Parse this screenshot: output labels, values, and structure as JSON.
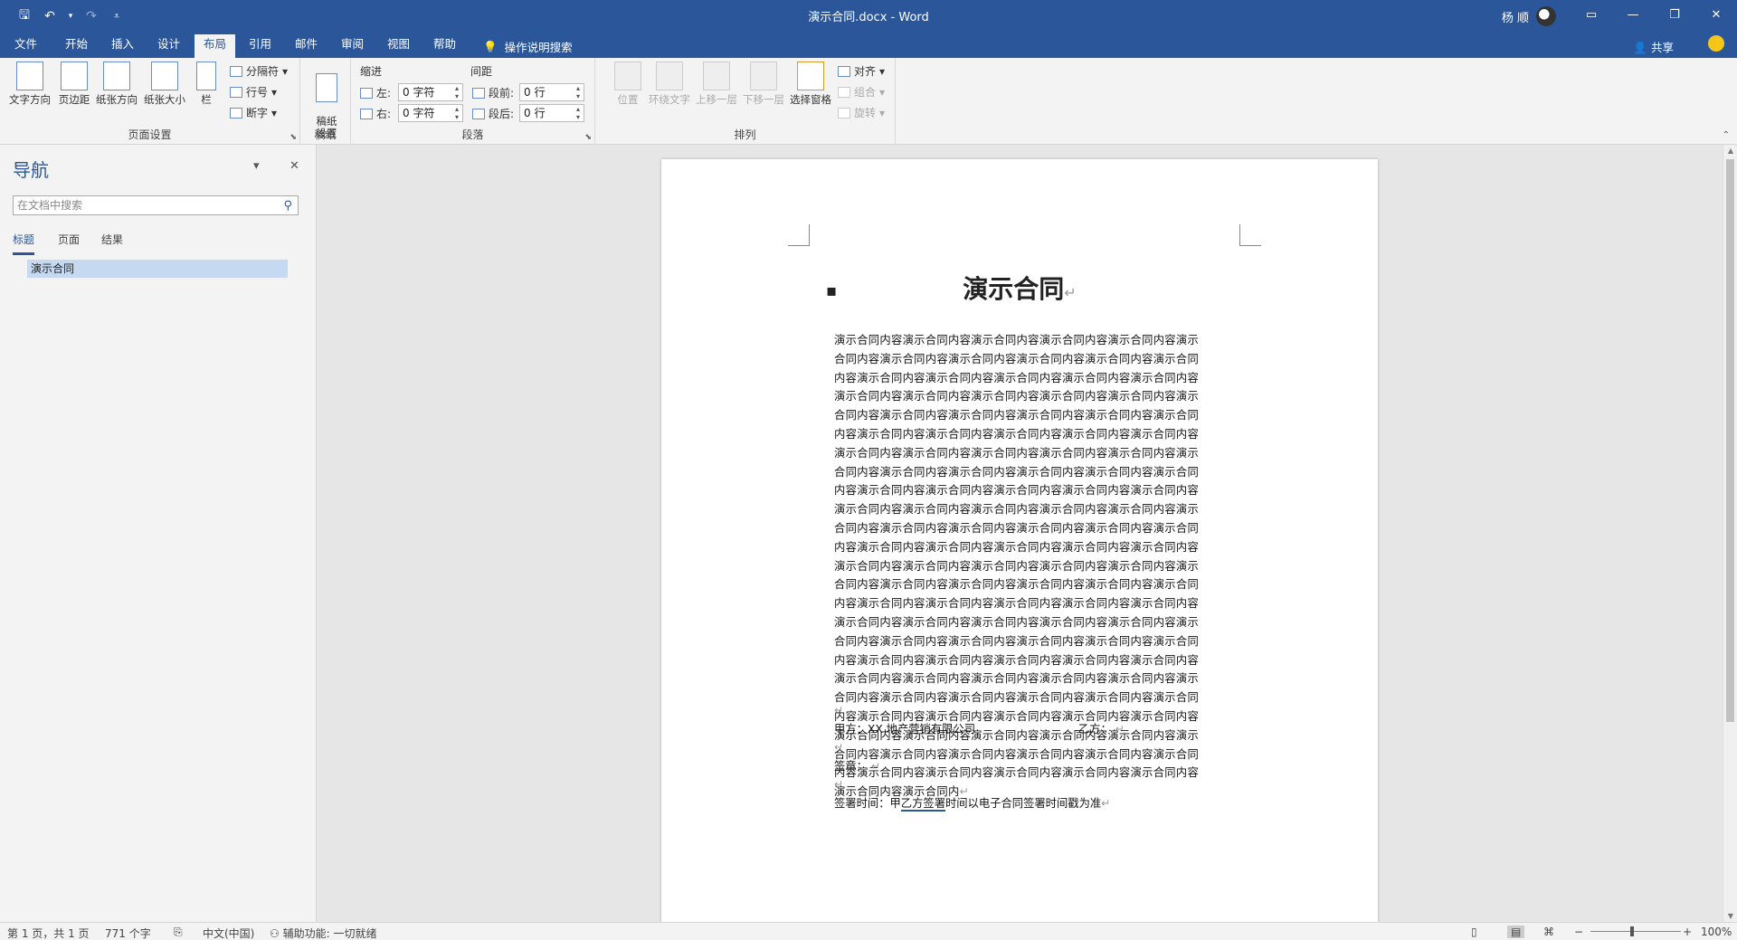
{
  "titlebar": {
    "doc_title": "演示合同.docx  -  Word",
    "user_name": "杨 顺",
    "qat": [
      "save-icon",
      "undo-icon",
      "redo-icon",
      "customize-icon"
    ],
    "window_buttons": [
      "ribbon-display-icon",
      "minimize-icon",
      "restore-icon",
      "close-icon"
    ],
    "glyphs": {
      "save": "🖫",
      "undo": "↶",
      "undo_drop": "▾",
      "redo": "↷",
      "customize": "⩡",
      "ribbon": "▭",
      "min": "—",
      "restore": "❐",
      "close": "✕"
    }
  },
  "menu": {
    "tabs": [
      "文件",
      "开始",
      "插入",
      "设计",
      "布局",
      "引用",
      "邮件",
      "审阅",
      "视图",
      "帮助"
    ],
    "active_tab": "布局",
    "tell_me": "操作说明搜索",
    "share": "共享"
  },
  "ribbon": {
    "page_setup": {
      "label": "页面设置",
      "buttons": [
        "文字方向",
        "页边距",
        "纸张方向",
        "纸张大小",
        "栏"
      ],
      "small": [
        "分隔符",
        "行号",
        "断字"
      ]
    },
    "manuscript": {
      "label": "稿纸",
      "button": "稿纸\n设置"
    },
    "paragraph": {
      "label": "段落",
      "indent_header": "缩进",
      "spacing_header": "间距",
      "indent_left_label": "左:",
      "indent_left_value": "0 字符",
      "indent_right_label": "右:",
      "indent_right_value": "0 字符",
      "before_label": "段前:",
      "before_value": "0 行",
      "after_label": "段后:",
      "after_value": "0 行"
    },
    "arrange": {
      "label": "排列",
      "buttons": [
        "位置",
        "环绕文字",
        "上移一层",
        "下移一层",
        "选择窗格"
      ],
      "small": [
        "对齐",
        "组合",
        "旋转"
      ]
    }
  },
  "nav": {
    "title": "导航",
    "search_placeholder": "在文档中搜索",
    "tabs": [
      "标题",
      "页面",
      "结果"
    ],
    "active_tab": "标题",
    "headings": [
      "演示合同"
    ],
    "controls": {
      "dropdown": "▾",
      "close": "✕",
      "search": "⚲"
    }
  },
  "document": {
    "title": "演示合同",
    "paragraph_mark": "↵",
    "body": "演示合同内容演示合同内容演示合同内容演示合同内容演示合同内容演示合同内容演示合同内容演示合同内容演示合同内容演示合同内容演示合同内容演示合同内容演示合同内容演示合同内容演示合同内容演示合同内容演示合同内容演示合同内容演示合同内容演示合同内容演示合同内容演示合同内容演示合同内容演示合同内容演示合同内容演示合同内容演示合同内容演示合同内容演示合同内容演示合同内容演示合同内容演示合同内容演示合同内容演示合同内容演示合同内容演示合同内容演示合同内容演示合同内容演示合同内容演示合同内容演示合同内容演示合同内容演示合同内容演示合同内容演示合同内容演示合同内容演示合同内容演示合同内容演示合同内容演示合同内容演示合同内容演示合同内容演示合同内容演示合同内容演示合同内容演示合同内容演示合同内容演示合同内容演示合同内容演示合同内容演示合同内容演示合同内容演示合同内容演示合同内容演示合同内容演示合同内容演示合同内容演示合同内容演示合同内容演示合同内容演示合同内容演示合同内容演示合同内容演示合同内容演示合同内容演示合同内容演示合同内容演示合同内容演示合同内容演示合同内容演示合同内容演示合同内容演示合同内容演示合同内容演示合同内容演示合同内容演示合同内容演示合同内容演示合同内容演示合同内容演示合同内容演示合同内容演示合同内容演示合同内容演示合同内容演示合同内容演示合同内容演示合同内容演示合同内容演示合同内容演示合同内容演示合同内容演示合同内容演示合同内容演示合同内容演示合同内容演示合同内容演示合同内容演示合同内容演示合同内容演示合同内容演示合同内容演示合同内容演示合同内容演示合同内容演示合同内容演示合同内容演示合同内容演示合同内容演示合同内容演示合同内容演示合同内容演示合同内容演示合同内容演示合同内容演示合同内容演示合同内容演示合同内容演示合同内容演示合同内",
    "party_a": "甲方：XX 地产营销有限公司",
    "party_b": "乙方：",
    "seal": "签章：",
    "sign_time_prefix": "签署时间：甲",
    "sign_time_underlined": "乙方签署",
    "sign_time_suffix": "时间以电子合同签署时间戳为准"
  },
  "status": {
    "page": "第 1 页，共 1 页",
    "words": "771 个字",
    "language": "中文(中国)",
    "accessibility": "辅助功能: 一切就绪",
    "zoom": "100%",
    "glyphs": {
      "proofing": "⎘",
      "accessibility": "⚇",
      "read": "▯",
      "print": "▤",
      "web": "⌘",
      "minus": "−",
      "plus": "+"
    }
  },
  "colors": {
    "brand": "#2b579a",
    "selection": "#c5d9f1"
  }
}
